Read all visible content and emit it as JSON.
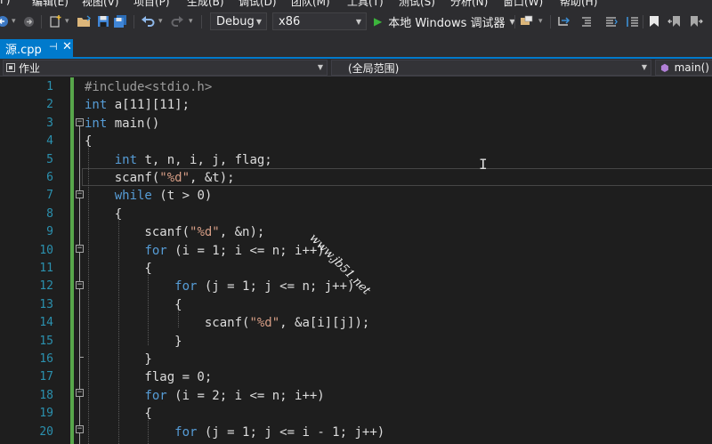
{
  "menu": [
    "F)",
    "编辑(E)",
    "视图(V)",
    "项目(P)",
    "生成(B)",
    "调试(D)",
    "团队(M)",
    "工具(T)",
    "测试(S)",
    "分析(N)",
    "窗口(W)",
    "帮助(H)"
  ],
  "toolbar": {
    "config": "Debug",
    "platform": "x86",
    "run_label": "本地 Windows 调试器"
  },
  "tab": {
    "label": "源.cpp",
    "pin": "⊣",
    "close": "✕"
  },
  "navbar": {
    "project": "作业",
    "scope": "(全局范围)",
    "member": "main()"
  },
  "colors": {
    "accent": "#007acc",
    "keyword": "#569cd6",
    "string": "#d69d85",
    "line_number": "#2b91af",
    "changed_bar": "#57a64a"
  },
  "code": {
    "line_numbers": [
      "1",
      "2",
      "3",
      "4",
      "5",
      "6",
      "7",
      "8",
      "9",
      "10",
      "11",
      "12",
      "13",
      "14",
      "15",
      "16",
      "17",
      "18",
      "19",
      "20"
    ],
    "lines": [
      [
        {
          "t": "#include<stdio.h>",
          "c": "pp"
        }
      ],
      [
        {
          "t": "int",
          "c": "kw"
        },
        {
          "t": " a[11][11];"
        }
      ],
      [
        {
          "t": "int",
          "c": "kw"
        },
        {
          "t": " main()"
        }
      ],
      [
        {
          "t": "{"
        }
      ],
      [
        {
          "t": "    "
        },
        {
          "t": "int",
          "c": "kw"
        },
        {
          "t": " t, n, i, j, flag;"
        }
      ],
      [
        {
          "t": "    scanf("
        },
        {
          "t": "\"%d\"",
          "c": "str"
        },
        {
          "t": ", &t);"
        }
      ],
      [
        {
          "t": "    "
        },
        {
          "t": "while",
          "c": "kw"
        },
        {
          "t": " (t > 0)"
        }
      ],
      [
        {
          "t": "    {"
        }
      ],
      [
        {
          "t": "        scanf("
        },
        {
          "t": "\"%d\"",
          "c": "str"
        },
        {
          "t": ", &n);"
        }
      ],
      [
        {
          "t": "        "
        },
        {
          "t": "for",
          "c": "kw"
        },
        {
          "t": " (i = 1; i <= n; i++)"
        }
      ],
      [
        {
          "t": "        {"
        }
      ],
      [
        {
          "t": "            "
        },
        {
          "t": "for",
          "c": "kw"
        },
        {
          "t": " (j = 1; j <= n; j++)"
        }
      ],
      [
        {
          "t": "            {"
        }
      ],
      [
        {
          "t": "                scanf("
        },
        {
          "t": "\"%d\"",
          "c": "str"
        },
        {
          "t": ", &a[i][j]);"
        }
      ],
      [
        {
          "t": "            }"
        }
      ],
      [
        {
          "t": "        }"
        }
      ],
      [
        {
          "t": "        flag = 0;"
        }
      ],
      [
        {
          "t": "        "
        },
        {
          "t": "for",
          "c": "kw"
        },
        {
          "t": " (i = 2; i <= n; i++)"
        }
      ],
      [
        {
          "t": "        {"
        }
      ],
      [
        {
          "t": "            "
        },
        {
          "t": "for",
          "c": "kw"
        },
        {
          "t": " (j = 1; j <= i - 1; j++)"
        }
      ]
    ],
    "fold_lines": [
      3,
      7,
      10,
      12,
      18,
      20
    ]
  },
  "watermark": "www.jb51.net"
}
